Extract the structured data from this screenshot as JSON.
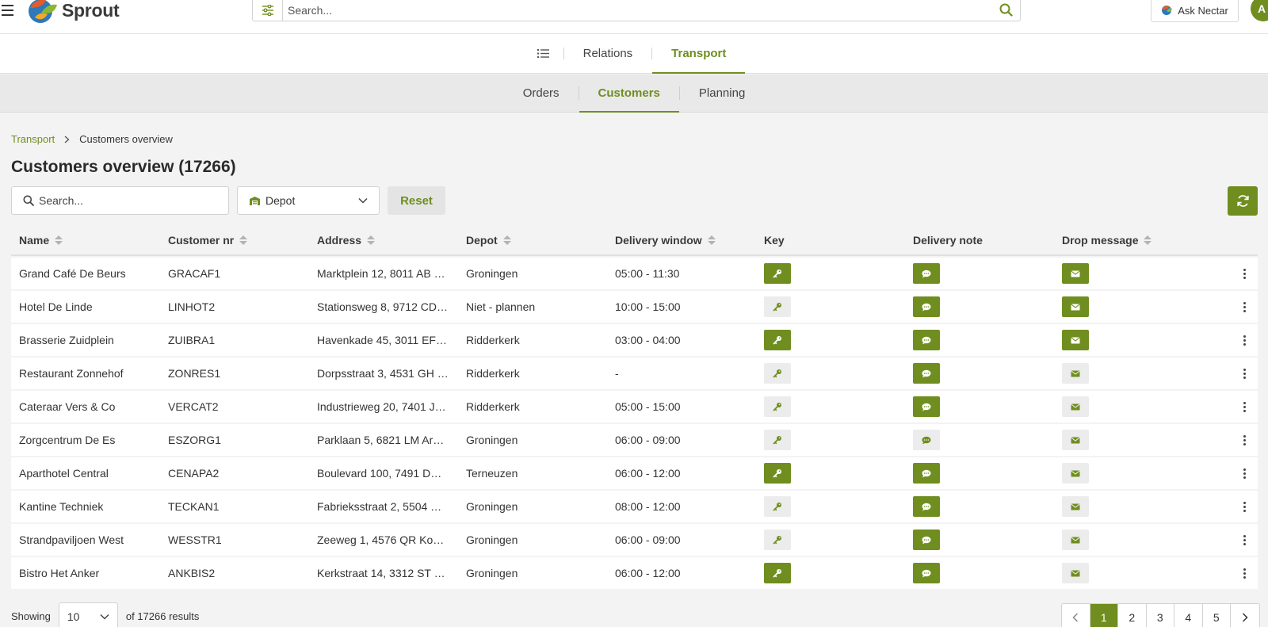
{
  "app": {
    "name": "Sprout"
  },
  "topbar": {
    "search_placeholder": "Search...",
    "ask_nectar_label": "Ask Nectar",
    "avatar_initial": "A"
  },
  "main_tabs": [
    {
      "label": "Relations",
      "active": false
    },
    {
      "label": "Transport",
      "active": true
    }
  ],
  "sub_tabs": [
    {
      "label": "Orders",
      "active": false
    },
    {
      "label": "Customers",
      "active": true
    },
    {
      "label": "Planning",
      "active": false
    }
  ],
  "breadcrumb": {
    "root": "Transport",
    "current": "Customers overview"
  },
  "page": {
    "title": "Customers overview (17266)"
  },
  "filters": {
    "search_placeholder": "Search...",
    "depot_label": "Depot",
    "reset_label": "Reset"
  },
  "table": {
    "headers": {
      "name": "Name",
      "customer_nr": "Customer nr",
      "address": "Address",
      "depot": "Depot",
      "delivery_window": "Delivery window",
      "key": "Key",
      "delivery_note": "Delivery note",
      "drop_message": "Drop message"
    },
    "rows": [
      {
        "name": "Grand Café De Beurs",
        "customer_nr": "GRACAF1",
        "address": "Marktplein 12, 8011 AB …",
        "depot": "Groningen",
        "delivery_window": "05:00 - 11:30",
        "key": true,
        "note": true,
        "drop": true
      },
      {
        "name": "Hotel De Linde",
        "customer_nr": "LINHOT2",
        "address": "Stationsweg 8, 9712 CD…",
        "depot": "Niet - plannen",
        "delivery_window": "10:00 - 15:00",
        "key": false,
        "note": true,
        "drop": true
      },
      {
        "name": "Brasserie Zuidplein",
        "customer_nr": "ZUIBRA1",
        "address": "Havenkade 45, 3011 EF…",
        "depot": "Ridderkerk",
        "delivery_window": "03:00 - 04:00",
        "key": true,
        "note": true,
        "drop": true
      },
      {
        "name": "Restaurant Zonnehof",
        "customer_nr": "ZONRES1",
        "address": "Dorpsstraat 3, 4531 GH …",
        "depot": "Ridderkerk",
        "delivery_window": "-",
        "key": false,
        "note": true,
        "drop": false
      },
      {
        "name": "Cateraar Vers & Co",
        "customer_nr": "VERCAT2",
        "address": "Industrieweg 20, 7401 J…",
        "depot": "Ridderkerk",
        "delivery_window": "05:00 - 15:00",
        "key": false,
        "note": true,
        "drop": false
      },
      {
        "name": "Zorgcentrum De Es",
        "customer_nr": "ESZORG1",
        "address": "Parklaan 5, 6821 LM Ar…",
        "depot": "Groningen",
        "delivery_window": "06:00 - 09:00",
        "key": false,
        "note": false,
        "drop": false
      },
      {
        "name": "Aparthotel Central",
        "customer_nr": "CENAPA2",
        "address": "Boulevard 100, 7491 D…",
        "depot": "Terneuzen",
        "delivery_window": "06:00 - 12:00",
        "key": true,
        "note": true,
        "drop": false
      },
      {
        "name": "Kantine Techniek",
        "customer_nr": "TECKAN1",
        "address": "Fabrieksstraat 2, 5504 …",
        "depot": "Groningen",
        "delivery_window": "08:00 - 12:00",
        "key": false,
        "note": true,
        "drop": false
      },
      {
        "name": "Strandpaviljoen West",
        "customer_nr": "WESSTR1",
        "address": "Zeeweg 1, 4576 QR Ko…",
        "depot": "Groningen",
        "delivery_window": "06:00 - 09:00",
        "key": false,
        "note": true,
        "drop": false
      },
      {
        "name": "Bistro Het Anker",
        "customer_nr": "ANKBIS2",
        "address": "Kerkstraat 14, 3312 ST …",
        "depot": "Groningen",
        "delivery_window": "06:00 - 12:00",
        "key": true,
        "note": true,
        "drop": false
      }
    ]
  },
  "footer": {
    "showing_label": "Showing",
    "page_size": "10",
    "results_text": "of 17266 results",
    "pages": [
      "1",
      "2",
      "3",
      "4",
      "5"
    ],
    "current_page": "1"
  },
  "colors": {
    "accent": "#6f8e1f",
    "inactive_icon_bg": "#ececec"
  }
}
